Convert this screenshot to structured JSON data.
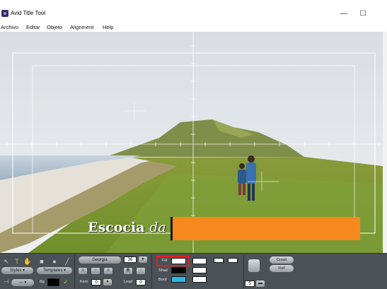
{
  "window": {
    "title": "Avid Title Tool",
    "minimize_glyph": "—",
    "maximize_glyph": "☐"
  },
  "menu": [
    "Archivo",
    "Editar",
    "Objeto",
    "Alignment",
    "Help"
  ],
  "canvas": {
    "title_text_main": "Escocia",
    "title_text_italic": "da",
    "bar_color": "#f5891e",
    "text_color": "#ffffff"
  },
  "toolbar": {
    "styles_label": "Styles",
    "templates_label": "Templates",
    "font_name": "Georgia",
    "font_size": "36",
    "bold_label": "B",
    "italic_label": "I",
    "kern_label": "Kern",
    "kern_value": "0",
    "lead_label": "Lead",
    "lead_value": "0",
    "bg_label": "Bg",
    "fill_label": "Fill",
    "shad_label": "Shad",
    "bord_label": "Bord",
    "crawl_label": "Crawl",
    "roll_label": "Roll",
    "depth_value": "5",
    "highlight_color": "#e0201e",
    "border_swatch_color": "#29b8e8"
  }
}
